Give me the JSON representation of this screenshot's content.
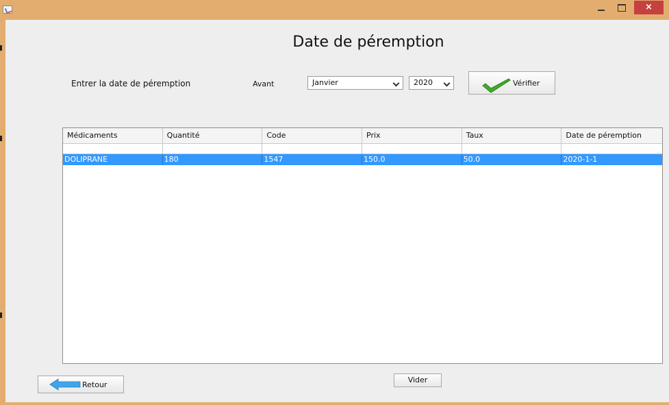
{
  "window": {
    "icon": "java-app-icon",
    "controls": {
      "minimize": "minimize-icon",
      "maximize": "maximize-icon",
      "close": "×"
    },
    "title_bar_color": "#e3ad6f"
  },
  "heading": "Date de péremption",
  "filter": {
    "prompt": "Entrer la date de péremption",
    "before_label": "Avant",
    "month": "Janvier",
    "year": "2020",
    "verify_label": "Vérifier",
    "verify_icon": "green-check-icon"
  },
  "table": {
    "columns": [
      "Médicaments",
      "Quantité",
      "Code",
      "Prix",
      "Taux",
      "Date de péremption"
    ],
    "rows": [
      [
        "DOLIPRANE",
        "180",
        "1547",
        "150.0",
        "50.0",
        "2020-1-1"
      ]
    ],
    "selected_row": 0,
    "selection_color": "#3399ff"
  },
  "buttons": {
    "back_label": "Retour",
    "back_icon": "blue-left-arrow-icon",
    "clear_label": "Vider"
  }
}
